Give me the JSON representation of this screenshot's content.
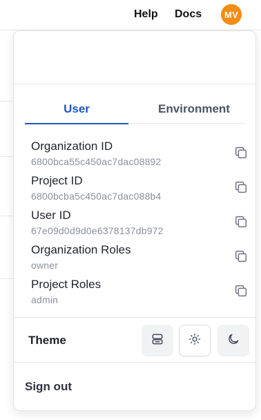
{
  "topbar": {
    "help_label": "Help",
    "docs_label": "Docs",
    "avatar_initials": "MV",
    "avatar_color": "#f28c12"
  },
  "tabs": [
    {
      "label": "User",
      "active": true
    },
    {
      "label": "Environment",
      "active": false
    }
  ],
  "fields": [
    {
      "label": "Organization ID",
      "value": "6800bca55c450ac7dac08892",
      "icon": "copy-icon"
    },
    {
      "label": "Project ID",
      "value": "6800bcba5c450ac7dac088b4",
      "icon": "copy-icon"
    },
    {
      "label": "User ID",
      "value": "67e09d0d9d0e6378137db972",
      "icon": "copy-icon"
    },
    {
      "label": "Organization Roles",
      "value": "owner",
      "icon": "copy-icon"
    },
    {
      "label": "Project Roles",
      "value": "admin",
      "icon": "copy-icon"
    }
  ],
  "theme": {
    "label": "Theme",
    "options": [
      {
        "name": "system",
        "icon": "server-icon"
      },
      {
        "name": "light",
        "icon": "sun-icon",
        "selected": true
      },
      {
        "name": "dark",
        "icon": "moon-icon"
      }
    ]
  },
  "signout_label": "Sign out",
  "colors": {
    "accent": "#1a56c4",
    "muted_text": "#8a8f98"
  }
}
